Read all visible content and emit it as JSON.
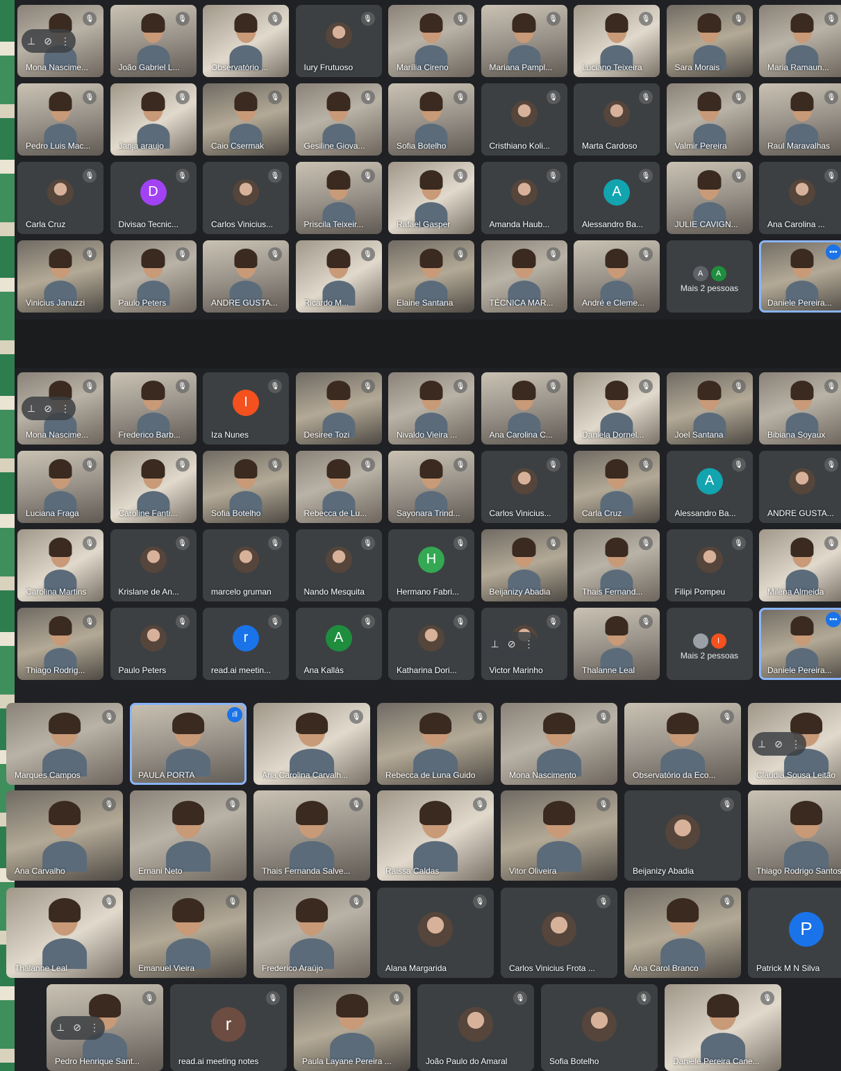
{
  "colors": {
    "bg": "#202124",
    "tile": "#3c4043",
    "active_outline": "#8ab4f8"
  },
  "icons": {
    "muted": "mic-off-icon",
    "pin": "pin-icon",
    "more": "more-vert-icon",
    "speaking": "speaking-icon"
  },
  "panel1": {
    "tiles": [
      {
        "name": "Mona Nascime...",
        "type": "video",
        "controls": true
      },
      {
        "name": "João Gabriel L...",
        "type": "video"
      },
      {
        "name": "Observatório ...",
        "type": "video"
      },
      {
        "name": "Iury Frutuoso",
        "type": "avatar-photo"
      },
      {
        "name": "Marília Cireno",
        "type": "video"
      },
      {
        "name": "Mariana Pampl...",
        "type": "video"
      },
      {
        "name": "Luciano Teixeira",
        "type": "video"
      },
      {
        "name": "Sara Morais",
        "type": "video"
      },
      {
        "name": "Maria Ramaun...",
        "type": "video"
      },
      {
        "name": "Pedro Luis Mac...",
        "type": "video"
      },
      {
        "name": "Janja araujo",
        "type": "video"
      },
      {
        "name": "Caio Csermak",
        "type": "video"
      },
      {
        "name": "Gesiline Giova...",
        "type": "video"
      },
      {
        "name": "Sofia Botelho",
        "type": "video"
      },
      {
        "name": "Cristhiano Koli...",
        "type": "avatar-photo"
      },
      {
        "name": "Marta Cardoso",
        "type": "avatar-photo"
      },
      {
        "name": "Valmir Pereira",
        "type": "video"
      },
      {
        "name": "Raul Maravalhas",
        "type": "video"
      },
      {
        "name": "Carla Cruz",
        "type": "avatar-photo"
      },
      {
        "name": "Divisao Tecnic...",
        "type": "avatar",
        "letter": "D",
        "color": "#a142f4"
      },
      {
        "name": "Carlos Vinicius...",
        "type": "avatar-photo"
      },
      {
        "name": "Priscila Teixeir...",
        "type": "video"
      },
      {
        "name": "Rafael Gasper",
        "type": "video"
      },
      {
        "name": "Amanda Haub...",
        "type": "avatar-photo"
      },
      {
        "name": "Alessandro Ba...",
        "type": "avatar",
        "letter": "A",
        "color": "#12a4af"
      },
      {
        "name": "JULIE CAVIGN...",
        "type": "video"
      },
      {
        "name": "Ana Carolina ...",
        "type": "avatar-photo"
      },
      {
        "name": "Vinicius Januzzi",
        "type": "video"
      },
      {
        "name": "Paulo Peters",
        "type": "video"
      },
      {
        "name": "ANDRE GUSTA...",
        "type": "video"
      },
      {
        "name": "Ricardo M...",
        "type": "video"
      },
      {
        "name": "Elaine Santana",
        "type": "video"
      },
      {
        "name": "TÉCNICA MAR...",
        "type": "video"
      },
      {
        "name": "André e Cleme...",
        "type": "video"
      },
      {
        "name": "",
        "type": "more",
        "label": "Mais 2 pessoas",
        "letters": [
          "A",
          "A"
        ],
        "colors": [
          "#5f6368",
          "#1e8e3e"
        ]
      },
      {
        "name": "Daniele Pereira...",
        "type": "video",
        "active": true,
        "badge": "•••"
      }
    ]
  },
  "panel2": {
    "tiles": [
      {
        "name": "Mona Nascime...",
        "type": "video",
        "controls": true
      },
      {
        "name": "Frederico Barb...",
        "type": "video"
      },
      {
        "name": "Iza Nunes",
        "type": "avatar",
        "letter": "I",
        "color": "#f4511e"
      },
      {
        "name": "Desiree Tozi",
        "type": "video"
      },
      {
        "name": "Nivaldo Vieira ...",
        "type": "video"
      },
      {
        "name": "Ana Carolina C...",
        "type": "video"
      },
      {
        "name": "Daniela Dornel...",
        "type": "video"
      },
      {
        "name": "Joel Santana",
        "type": "video"
      },
      {
        "name": "Bibiana Soyaux",
        "type": "video"
      },
      {
        "name": "Luciana Fraga",
        "type": "video"
      },
      {
        "name": "Caroline Fanti...",
        "type": "video"
      },
      {
        "name": "Sofia Botelho",
        "type": "video"
      },
      {
        "name": "Rebecca de Lu...",
        "type": "video"
      },
      {
        "name": "Sayonara Trind...",
        "type": "video"
      },
      {
        "name": "Carlos Vinicius...",
        "type": "avatar-photo"
      },
      {
        "name": "Carla Cruz",
        "type": "video"
      },
      {
        "name": "Alessandro Ba...",
        "type": "avatar",
        "letter": "A",
        "color": "#12a4af"
      },
      {
        "name": "ANDRE GUSTA...",
        "type": "avatar-photo"
      },
      {
        "name": "Carolina Martins",
        "type": "video"
      },
      {
        "name": "Krislane de An...",
        "type": "avatar-photo"
      },
      {
        "name": "marcelo gruman",
        "type": "avatar-photo"
      },
      {
        "name": "Nando Mesquita",
        "type": "avatar-photo"
      },
      {
        "name": "Hermano Fabri...",
        "type": "avatar",
        "letter": "H",
        "color": "#34a853"
      },
      {
        "name": "Beijanizy Abadia",
        "type": "video"
      },
      {
        "name": "Thais Fernand...",
        "type": "video"
      },
      {
        "name": "Filipi Pompeu",
        "type": "avatar-photo"
      },
      {
        "name": "Milena Almeida",
        "type": "video"
      },
      {
        "name": "Thiago Rodrig...",
        "type": "video"
      },
      {
        "name": "Paulo Peters",
        "type": "avatar-photo"
      },
      {
        "name": "read.ai meetin...",
        "type": "avatar",
        "letter": "r",
        "color": "#1a73e8"
      },
      {
        "name": "Ana Kallás",
        "type": "avatar",
        "letter": "A",
        "color": "#1e8e3e"
      },
      {
        "name": "Katharina Dori...",
        "type": "avatar-photo"
      },
      {
        "name": "Victor Marinho",
        "type": "avatar-photo",
        "controls": true
      },
      {
        "name": "Thalanne Leal",
        "type": "video"
      },
      {
        "name": "",
        "type": "more",
        "label": "Mais 2 pessoas",
        "letters": [
          "",
          "I"
        ],
        "colors": [
          "#9aa0a6",
          "#f4511e"
        ]
      },
      {
        "name": "Daniele Pereira...",
        "type": "video",
        "active": true,
        "badge": "•••"
      }
    ]
  },
  "panel3": {
    "rows": [
      [
        {
          "name": "Marques Campos",
          "type": "video"
        },
        {
          "name": "PAULA PORTA",
          "type": "video",
          "active": true,
          "badge": "ıll"
        },
        {
          "name": "Ana Carolina Carvalh...",
          "type": "video"
        },
        {
          "name": "Rebecca de Luna Guido",
          "type": "video"
        },
        {
          "name": "Mona Nascimento",
          "type": "video"
        },
        {
          "name": "Observatório da Eco...",
          "type": "video"
        },
        {
          "name": "Cláudia Sousa Leitão",
          "type": "video",
          "controls": true
        }
      ],
      [
        {
          "name": "Ana Carvalho",
          "type": "video"
        },
        {
          "name": "Ernani Neto",
          "type": "video"
        },
        {
          "name": "Thais Fernanda Salve...",
          "type": "video"
        },
        {
          "name": "Raissa Caldas",
          "type": "video"
        },
        {
          "name": "Vitor Oliveira",
          "type": "video"
        },
        {
          "name": "Beijanizy Abadia",
          "type": "avatar-photo"
        },
        {
          "name": "Thiago Rodrigo Santos",
          "type": "video"
        }
      ],
      [
        {
          "name": "Thalanne Leal",
          "type": "video"
        },
        {
          "name": "Emanuel Vieira",
          "type": "video"
        },
        {
          "name": "Frederico Araújo",
          "type": "video"
        },
        {
          "name": "Alana Margarida",
          "type": "avatar-photo"
        },
        {
          "name": "Carlos Vinicius Frota ...",
          "type": "avatar-photo"
        },
        {
          "name": "Ana Carol Branco",
          "type": "video"
        },
        {
          "name": "Patrick M N Silva",
          "type": "avatar",
          "letter": "P",
          "color": "#1a73e8"
        }
      ],
      [
        {
          "name": "Pedro Henrique Sant...",
          "type": "video",
          "controls": true
        },
        {
          "name": "read.ai meeting notes",
          "type": "avatar",
          "letter": "r",
          "color": "#6d4c41"
        },
        {
          "name": "Paula Layane Pereira ...",
          "type": "video"
        },
        {
          "name": "João Paulo do Amaral",
          "type": "avatar-photo"
        },
        {
          "name": "Sofia Botelho",
          "type": "avatar-photo"
        },
        {
          "name": "Daniele Pereira Cane...",
          "type": "video"
        }
      ]
    ]
  }
}
